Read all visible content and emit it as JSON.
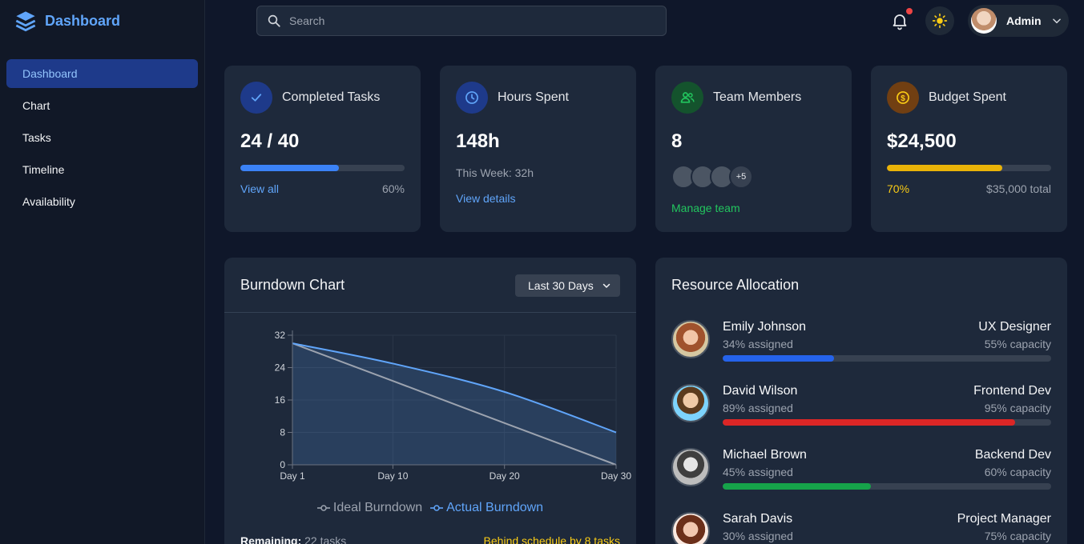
{
  "brand": {
    "name": "Dashboard"
  },
  "sidebar": {
    "items": [
      {
        "label": "Dashboard",
        "active": true
      },
      {
        "label": "Chart",
        "active": false
      },
      {
        "label": "Tasks",
        "active": false
      },
      {
        "label": "Timeline",
        "active": false
      },
      {
        "label": "Availability",
        "active": false
      }
    ]
  },
  "header": {
    "search_placeholder": "Search",
    "user_name": "Admin",
    "has_notification": true
  },
  "stats": {
    "completed": {
      "title": "Completed Tasks",
      "value": "24 / 40",
      "link": "View all",
      "percent_label": "60%",
      "progress": 0.6
    },
    "hours": {
      "title": "Hours Spent",
      "value": "148h",
      "subtext": "This Week: 32h",
      "link": "View details"
    },
    "team": {
      "title": "Team Members",
      "value": "8",
      "more_label": "+5",
      "link": "Manage team"
    },
    "budget": {
      "title": "Budget Spent",
      "value": "$24,500",
      "percent_label": "70%",
      "total_label": "$35,000 total",
      "progress": 0.7
    }
  },
  "burndown": {
    "title": "Burndown Chart",
    "range_select": "Last 30 Days",
    "remaining_label": "Remaining:",
    "remaining_value": "22 tasks",
    "status": "Behind schedule by 8 tasks"
  },
  "chart_data": {
    "type": "line",
    "title": "",
    "x": [
      "Day 1",
      "Day 10",
      "Day 20",
      "Day 30"
    ],
    "x_numeric": [
      1,
      10,
      20,
      30
    ],
    "ylim": [
      0,
      32
    ],
    "yticks": [
      0,
      8,
      16,
      24,
      32
    ],
    "grid": true,
    "legend_position": "bottom",
    "series": [
      {
        "name": "Ideal Burndown",
        "color": "#9ca3af",
        "values": [
          30,
          20.7,
          10.3,
          0
        ]
      },
      {
        "name": "Actual Burndown",
        "color": "#60a5fa",
        "values": [
          30,
          25,
          18,
          8
        ],
        "filled": true
      }
    ]
  },
  "resources": {
    "title": "Resource Allocation",
    "people": [
      {
        "name": "Emily Johnson",
        "assigned": "34% assigned",
        "role": "UX Designer",
        "capacity": "55% capacity",
        "progress": 0.34,
        "color": "#2563eb"
      },
      {
        "name": "David Wilson",
        "assigned": "89% assigned",
        "role": "Frontend Dev",
        "capacity": "95% capacity",
        "progress": 0.89,
        "color": "#dc2626"
      },
      {
        "name": "Michael Brown",
        "assigned": "45% assigned",
        "role": "Backend Dev",
        "capacity": "60% capacity",
        "progress": 0.45,
        "color": "#16a34a"
      },
      {
        "name": "Sarah Davis",
        "assigned": "30% assigned",
        "role": "Project Manager",
        "capacity": "75% capacity",
        "progress": 0.3,
        "color": "#2563eb"
      }
    ]
  },
  "colors": {
    "accent": "#60a5fa",
    "green": "#22c55e",
    "yellow": "#eab308",
    "warning": "#facc15"
  }
}
